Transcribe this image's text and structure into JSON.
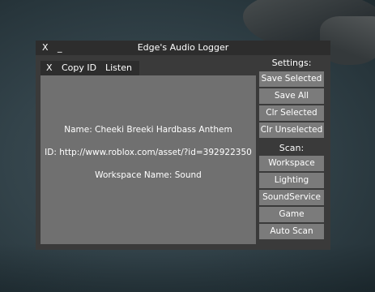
{
  "window": {
    "title": "Edge's Audio Logger",
    "close_label": "X",
    "minimize_label": "_"
  },
  "toolbar": {
    "close_label": "X",
    "copy_id_label": "Copy ID",
    "listen_label": "Listen"
  },
  "details": {
    "name_line": "Name: Cheeki Breeki Hardbass Anthem",
    "id_line": "ID: http://www.roblox.com/asset/?id=392922350",
    "workspace_line": "Workspace Name: Sound"
  },
  "settings": {
    "header": "Settings:",
    "buttons": [
      "Save Selected",
      "Save All",
      "Clr Selected",
      "Clr Unselected"
    ]
  },
  "scan": {
    "header": "Scan:",
    "buttons": [
      "Workspace",
      "Lighting",
      "SoundService",
      "Game",
      "Auto Scan"
    ]
  },
  "colors": {
    "titlebar": "#2d2d2d",
    "window": "#3a3a3a",
    "panel": "#707070",
    "button": "#7b7b7b",
    "text": "#ffffff"
  }
}
